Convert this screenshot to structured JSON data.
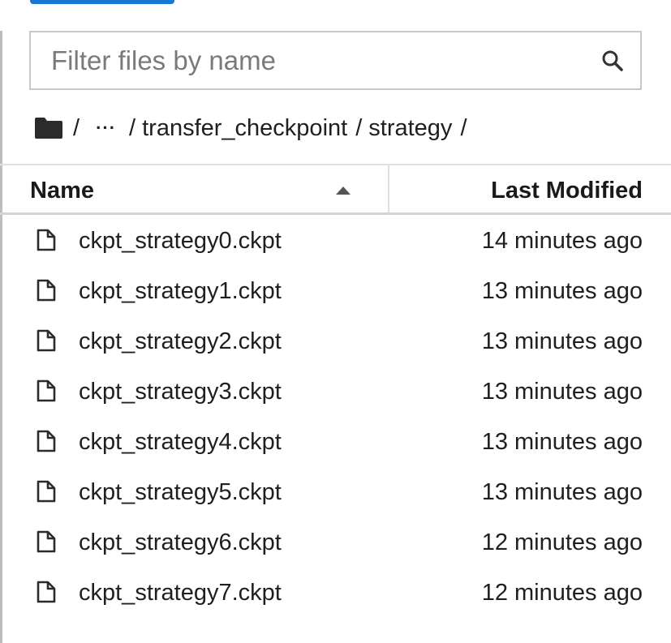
{
  "filter": {
    "placeholder": "Filter files by name",
    "value": ""
  },
  "breadcrumb": {
    "root_icon": "folder-icon",
    "separator": "/",
    "ellipsis": "···",
    "segments": [
      "transfer_checkpoint",
      "strategy"
    ]
  },
  "columns": {
    "name": "Name",
    "last_modified": "Last Modified",
    "sort_indicator": "ascending"
  },
  "files": [
    {
      "name": "ckpt_strategy0.ckpt",
      "modified": "14 minutes ago"
    },
    {
      "name": "ckpt_strategy1.ckpt",
      "modified": "13 minutes ago"
    },
    {
      "name": "ckpt_strategy2.ckpt",
      "modified": "13 minutes ago"
    },
    {
      "name": "ckpt_strategy3.ckpt",
      "modified": "13 minutes ago"
    },
    {
      "name": "ckpt_strategy4.ckpt",
      "modified": "13 minutes ago"
    },
    {
      "name": "ckpt_strategy5.ckpt",
      "modified": "13 minutes ago"
    },
    {
      "name": "ckpt_strategy6.ckpt",
      "modified": "12 minutes ago"
    },
    {
      "name": "ckpt_strategy7.ckpt",
      "modified": "12 minutes ago"
    }
  ],
  "colors": {
    "accent": "#1976d2",
    "border": "#c8c8c8",
    "text": "#1f1f1f"
  }
}
